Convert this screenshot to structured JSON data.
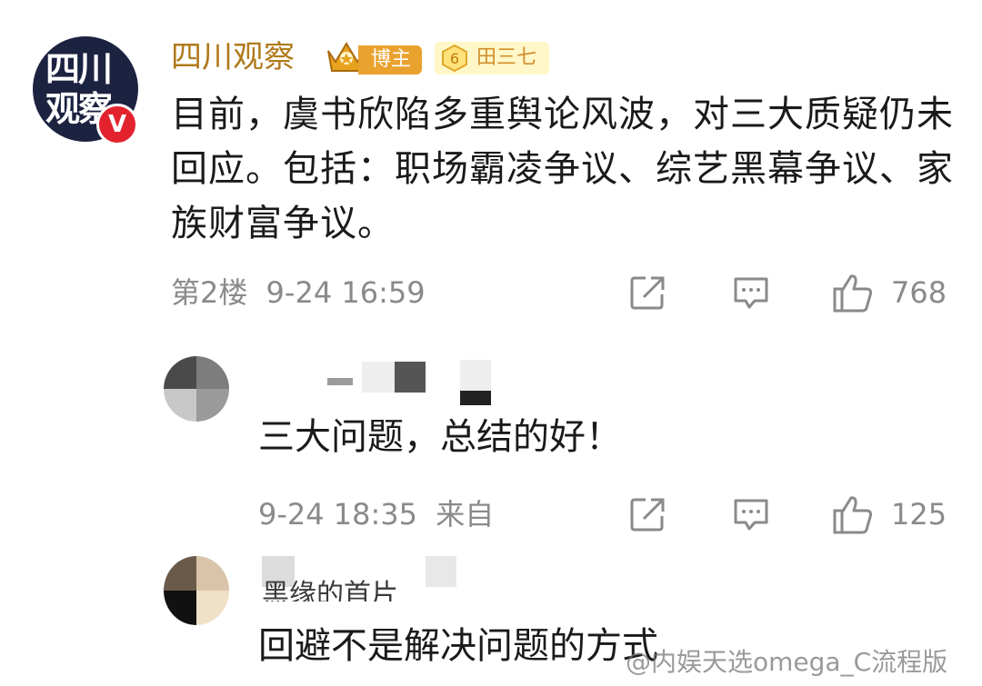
{
  "main_comment": {
    "avatar_text": "四川观察",
    "verified_mark": "V",
    "username": "四川观察",
    "badges": {
      "level_badge": "博主",
      "fan_level": "6",
      "fan_name": "田三七"
    },
    "content": "目前，虞书欣陷多重舆论风波，对三大质疑仍未回应。包括：职场霸凌争议、综艺黑幕争议、家族财富争议。",
    "floor": "第2楼",
    "time": "9-24 16:59",
    "likes": "768",
    "icons": [
      "share-icon",
      "comment-icon",
      "like-icon"
    ]
  },
  "replies": [
    {
      "content": "三大问题，总结的好！",
      "time": "9-24 18:35",
      "source_prefix": "来自",
      "likes": "125"
    },
    {
      "username_partial": "黑缘的首片",
      "content": "回避不是解决问题的方式"
    }
  ],
  "watermark": "@内娱天选omega_C流程版"
}
